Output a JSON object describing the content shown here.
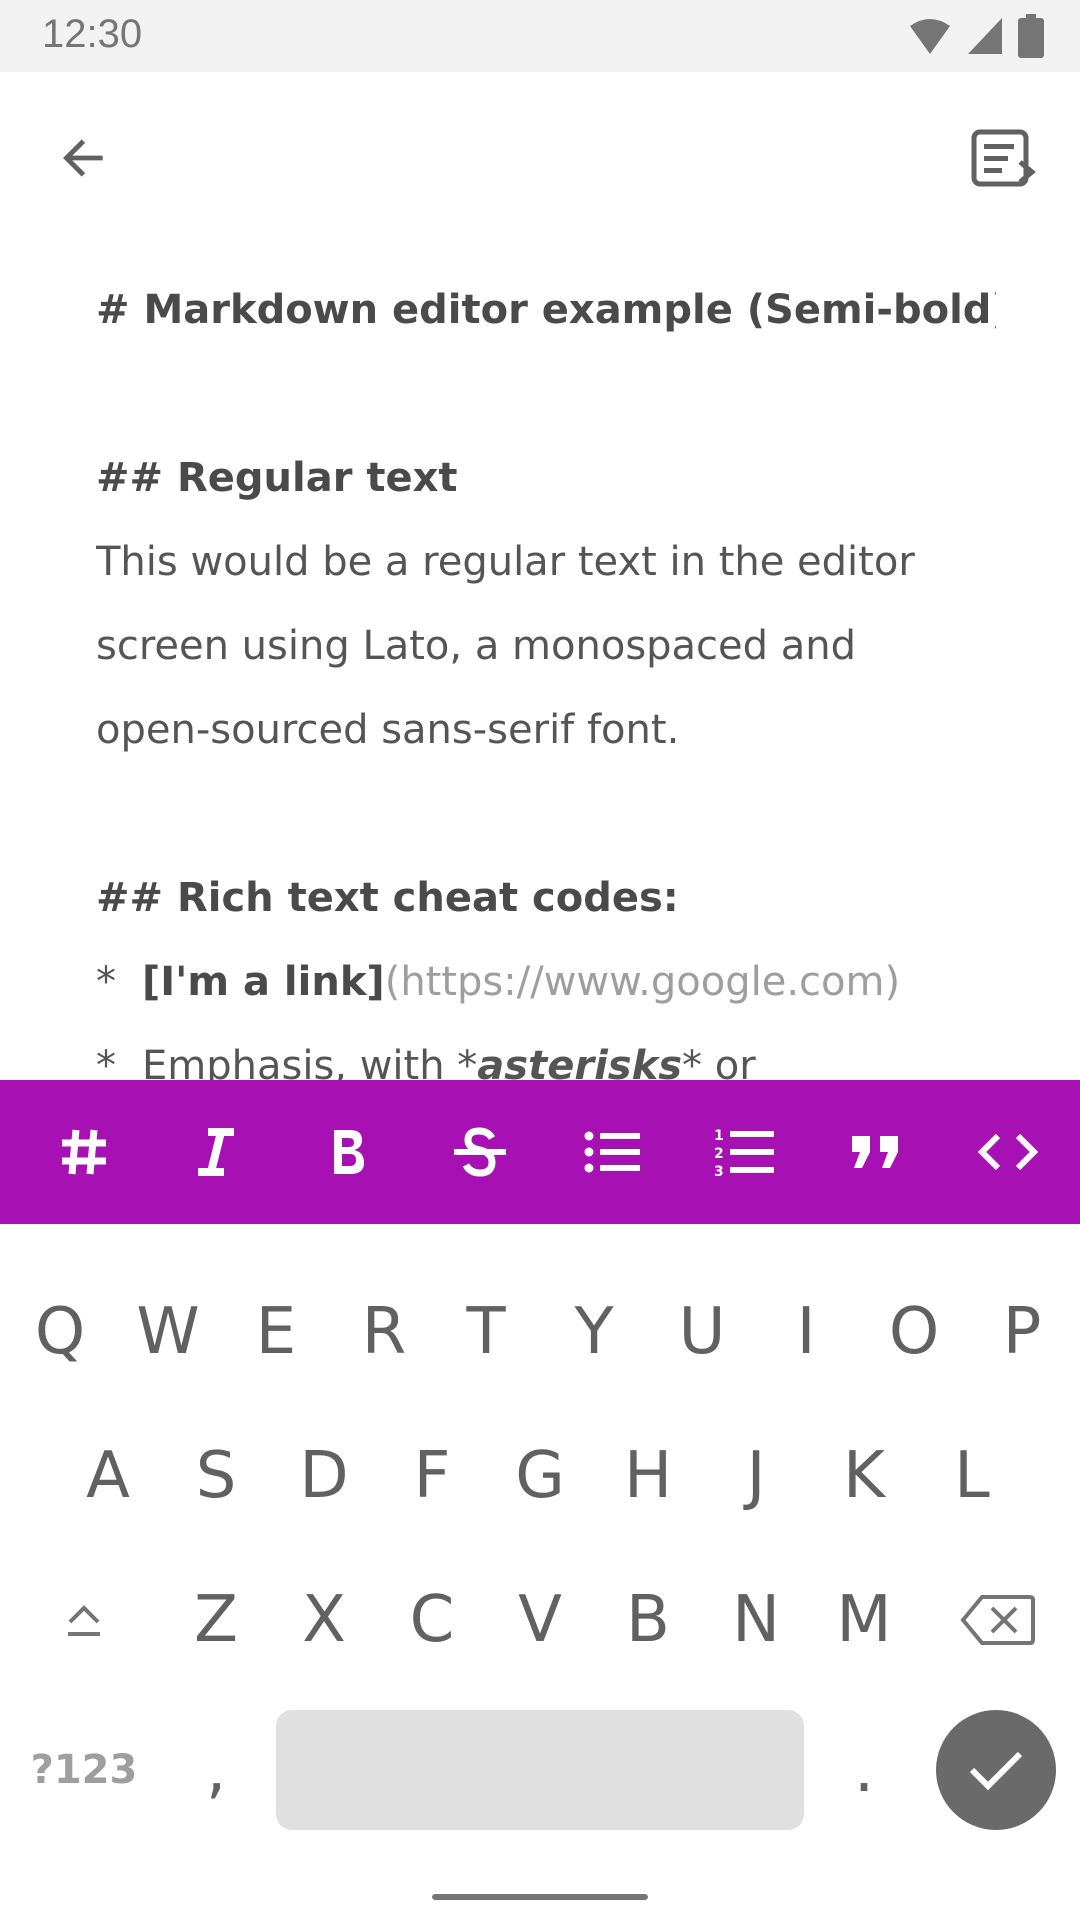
{
  "status_bar": {
    "time": "12:30",
    "icons": [
      "wifi-icon",
      "signal-icon",
      "battery-icon"
    ]
  },
  "app_bar": {
    "back_icon": "arrow-left-icon",
    "preview_icon": "markdown-preview-icon"
  },
  "editor": {
    "h1": "# Markdown editor example (Semi-bold)",
    "h2_regular": "## Regular text",
    "paragraph_lines": [
      "This would be a regular text in the editor",
      "screen using Lato, a monospaced and",
      "open-sourced sans-serif font."
    ],
    "h2_rich": "## Rich text cheat codes:",
    "bullet_marker": "*",
    "link_text": "[I'm a link]",
    "link_url": "(https://www.google.com)",
    "emphasis_prefix": "Emphasis, with *",
    "emphasis_word": "asterisks",
    "emphasis_suffix": "* or"
  },
  "format_toolbar": {
    "background": "#a711b3",
    "buttons": [
      "heading-icon",
      "italic-icon",
      "bold-icon",
      "strikethrough-icon",
      "bulleted-list-icon",
      "numbered-list-icon",
      "quote-icon",
      "code-icon"
    ]
  },
  "keyboard": {
    "row1": [
      "Q",
      "W",
      "E",
      "R",
      "T",
      "Y",
      "U",
      "I",
      "O",
      "P"
    ],
    "row2": [
      "A",
      "S",
      "D",
      "F",
      "G",
      "H",
      "J",
      "K",
      "L"
    ],
    "row3": [
      "Z",
      "X",
      "C",
      "V",
      "B",
      "N",
      "M"
    ],
    "symbols_key": "?123",
    "comma_key": ",",
    "period_key": "."
  }
}
